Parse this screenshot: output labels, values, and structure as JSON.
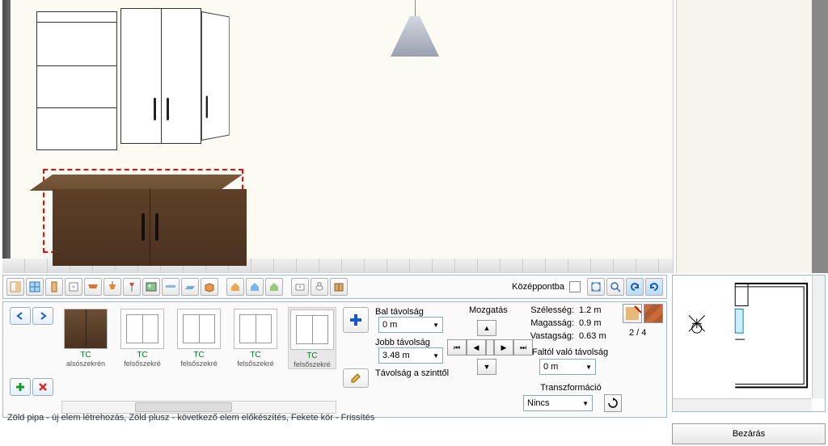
{
  "toolbar": {
    "center_label": "Középpontba"
  },
  "library": {
    "items": [
      {
        "title": "TC",
        "sub": "alsószekrén"
      },
      {
        "title": "TC",
        "sub": "felsőszekré"
      },
      {
        "title": "TC",
        "sub": "felsőszekré"
      },
      {
        "title": "TC",
        "sub": "felsőszekré"
      },
      {
        "title": "TC",
        "sub": "felsőszekré"
      }
    ]
  },
  "props": {
    "left_distance_label": "Bal távolság",
    "left_distance_value": "0 m",
    "right_distance_label": "Jobb távolság",
    "right_distance_value": "3.48 m",
    "level_distance_label": "Távolság a szinttől",
    "move_label": "Mozgatás"
  },
  "dims": {
    "width_label": "Szélesség:",
    "width_value": "1.2 m",
    "height_label": "Magasság:",
    "height_value": "0.9 m",
    "thick_label": "Vastagság:",
    "thick_value": "0.63 m"
  },
  "wall_distance": {
    "label": "Faltól való távolság",
    "value": "0 m"
  },
  "transform": {
    "label": "Transzformáció",
    "value": "Nincs"
  },
  "page_indicator": "2 / 4",
  "status": "Zöld pipa - új elem létrehozás, Zöld plusz - következő elem előkészítés, Fekete kör - Frissítés",
  "close_label": "Bezárás"
}
